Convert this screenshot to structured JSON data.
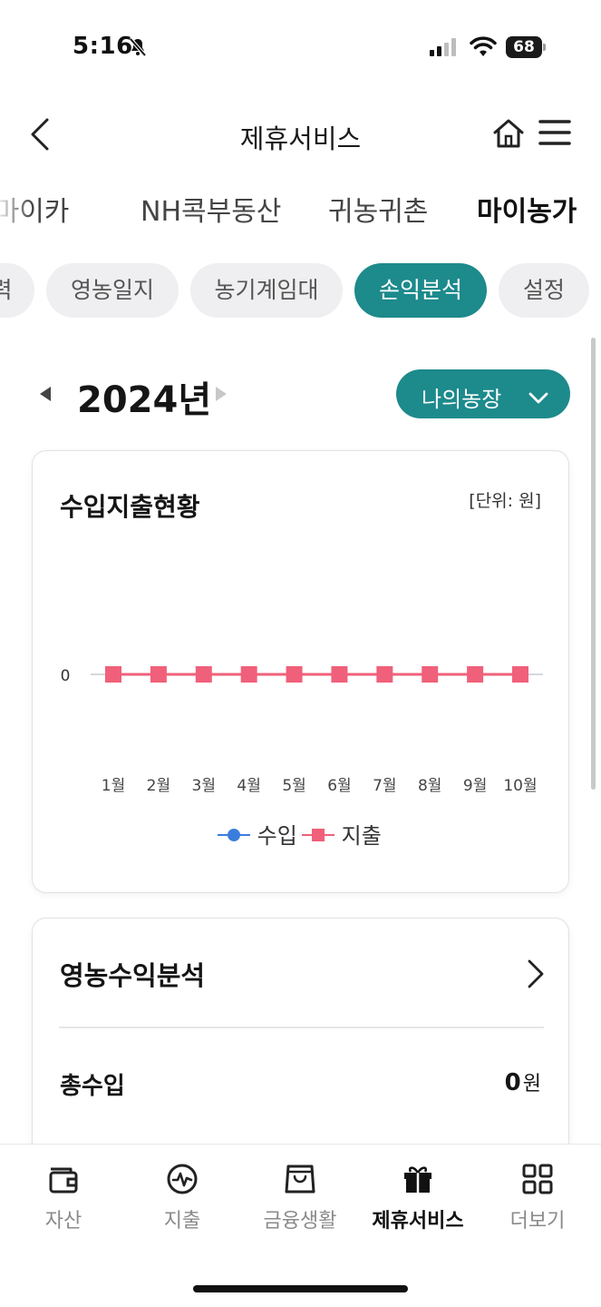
{
  "status_bar": {
    "time": "5:16",
    "battery": "68"
  },
  "header": {
    "title": "제휴서비스"
  },
  "top_tabs": [
    {
      "label": "콕마이카",
      "active": false
    },
    {
      "label": "NH콕부동산",
      "active": false
    },
    {
      "label": "귀농귀촌",
      "active": false
    },
    {
      "label": "마이농가",
      "active": true
    }
  ],
  "chips": [
    {
      "label": "력",
      "active": false
    },
    {
      "label": "영농일지",
      "active": false
    },
    {
      "label": "농기계임대",
      "active": false
    },
    {
      "label": "손익분석",
      "active": true
    },
    {
      "label": "설정",
      "active": false
    }
  ],
  "year_selector": {
    "year": "2024년",
    "farm_button": "나의농장"
  },
  "chart_card": {
    "title": "수입지출현황",
    "unit": "[단위: 원]"
  },
  "chart_data": {
    "type": "line",
    "title": "수입지출현황",
    "categories": [
      "1월",
      "2월",
      "3월",
      "4월",
      "5월",
      "6월",
      "7월",
      "8월",
      "9월",
      "10월"
    ],
    "y_ticks": [
      "0"
    ],
    "series": [
      {
        "name": "수입",
        "color": "#3b7ddd",
        "marker": "circle",
        "values": [
          0,
          0,
          0,
          0,
          0,
          0,
          0,
          0,
          0,
          0
        ]
      },
      {
        "name": "지출",
        "color": "#f0607a",
        "marker": "square",
        "values": [
          0,
          0,
          0,
          0,
          0,
          0,
          0,
          0,
          0,
          0
        ]
      }
    ],
    "legend": "bottom",
    "grid": false
  },
  "analysis_card": {
    "title": "영농수익분석",
    "rows": [
      {
        "label": "총수입",
        "value": "0",
        "unit": "원"
      }
    ]
  },
  "bottom_nav": [
    {
      "label": "자산",
      "icon": "wallet-icon",
      "active": false
    },
    {
      "label": "지출",
      "icon": "pulse-icon",
      "active": false
    },
    {
      "label": "금융생활",
      "icon": "shopping-bag-icon",
      "active": false
    },
    {
      "label": "제휴서비스",
      "icon": "gift-icon",
      "active": true
    },
    {
      "label": "더보기",
      "icon": "grid-icon",
      "active": false
    }
  ],
  "colors": {
    "accent": "#1d8a8c",
    "income": "#3b7ddd",
    "expense": "#f0607a"
  }
}
